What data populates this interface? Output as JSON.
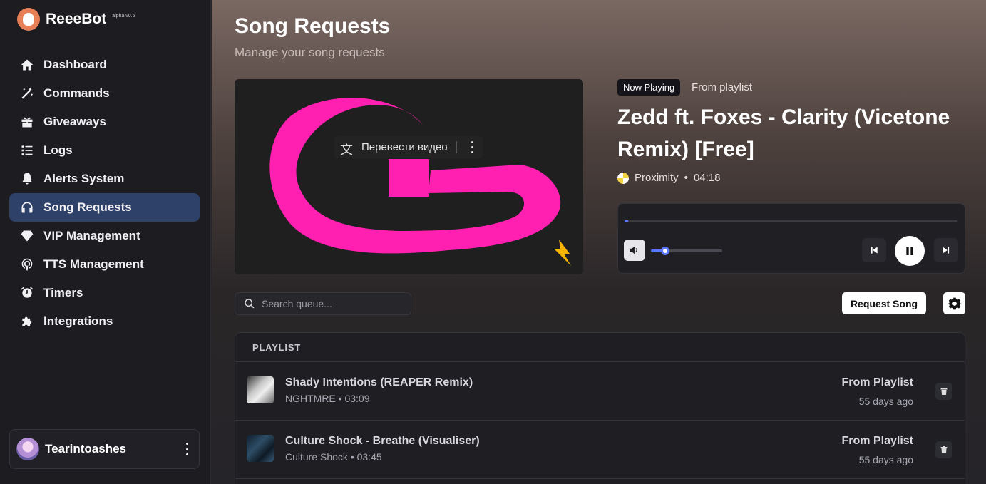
{
  "brand": {
    "name": "ReeeBot",
    "version": "alpha v0.6"
  },
  "sidebar": {
    "items": [
      {
        "label": "Dashboard",
        "icon": "home-icon"
      },
      {
        "label": "Commands",
        "icon": "magic-wand-icon"
      },
      {
        "label": "Giveaways",
        "icon": "gift-icon"
      },
      {
        "label": "Logs",
        "icon": "list-icon"
      },
      {
        "label": "Alerts System",
        "icon": "bell-icon"
      },
      {
        "label": "Song Requests",
        "icon": "headphones-icon",
        "active": true
      },
      {
        "label": "VIP Management",
        "icon": "diamond-icon"
      },
      {
        "label": "TTS Management",
        "icon": "podcast-icon"
      },
      {
        "label": "Timers",
        "icon": "alarm-clock-icon"
      },
      {
        "label": "Integrations",
        "icon": "puzzle-icon"
      }
    ]
  },
  "user": {
    "name": "Tearintoashes"
  },
  "page": {
    "title": "Song Requests",
    "subtitle": "Manage your song requests"
  },
  "video": {
    "translate_label": "Перевести видео"
  },
  "now_playing": {
    "badge": "Now Playing",
    "source": "From playlist",
    "title": "Zedd ft. Foxes - Clarity (Vicetone Remix) [Free]",
    "artist": "Proximity",
    "duration": "04:18",
    "progress": 0.01,
    "volume": 0.21
  },
  "queue": {
    "search_placeholder": "Search queue...",
    "request_label": "Request Song",
    "header": "PLAYLIST",
    "rows": [
      {
        "title": "Shady Intentions (REAPER Remix)",
        "sub": "NGHTMRE • 03:09",
        "source": "From Playlist",
        "time": "55 days ago"
      },
      {
        "title": "Culture Shock - Breathe (Visualiser)",
        "sub": "Culture Shock • 03:45",
        "source": "From Playlist",
        "time": "55 days ago"
      }
    ]
  },
  "colors": {
    "accent": "#5a76ff",
    "active_nav": "#2e4168",
    "logo_pink": "#ff1fb0"
  }
}
